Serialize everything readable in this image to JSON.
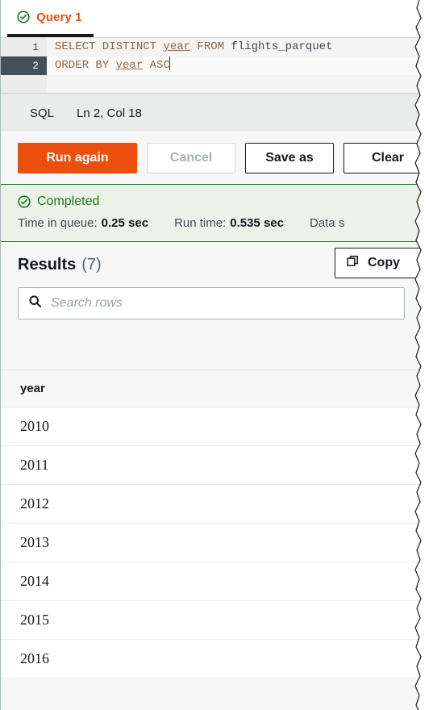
{
  "tab": {
    "label": "Query 1",
    "status_icon": "check-circle-icon"
  },
  "editor": {
    "language": "SQL",
    "cursor_position": "Ln 2, Col 18",
    "lines": [
      {
        "number": "1",
        "keyword1": "SELECT DISTINCT ",
        "identifier": "year",
        "keyword2": " FROM ",
        "table": "flights_parquet",
        "active": false
      },
      {
        "number": "2",
        "keyword1": "ORDER BY ",
        "identifier": "year",
        "keyword2": " ASC",
        "table": "",
        "active": true
      }
    ]
  },
  "actions": {
    "run_again": "Run again",
    "cancel": "Cancel",
    "save_as": "Save as",
    "clear": "Clear"
  },
  "banner": {
    "status": "Completed",
    "status_icon": "check-circle-icon",
    "metrics": [
      {
        "label": "Time in queue:",
        "value": "0.25 sec"
      },
      {
        "label": "Run time:",
        "value": "0.535 sec"
      },
      {
        "label": "Data s",
        "value": ""
      }
    ]
  },
  "results": {
    "title": "Results",
    "count": "(7)",
    "copy_label": "Copy",
    "copy_icon": "copy-icon",
    "search_placeholder": "Search rows",
    "search_icon": "search-icon",
    "search_value": "",
    "columns": [
      "year"
    ],
    "rows": [
      [
        "2010"
      ],
      [
        "2011"
      ],
      [
        "2012"
      ],
      [
        "2013"
      ],
      [
        "2014"
      ],
      [
        "2015"
      ],
      [
        "2016"
      ]
    ]
  },
  "colors": {
    "accent_orange": "#ec4f0b",
    "success_green": "#1d7324",
    "banner_bg": "#eaf4e6",
    "text_dark": "#16191f"
  }
}
